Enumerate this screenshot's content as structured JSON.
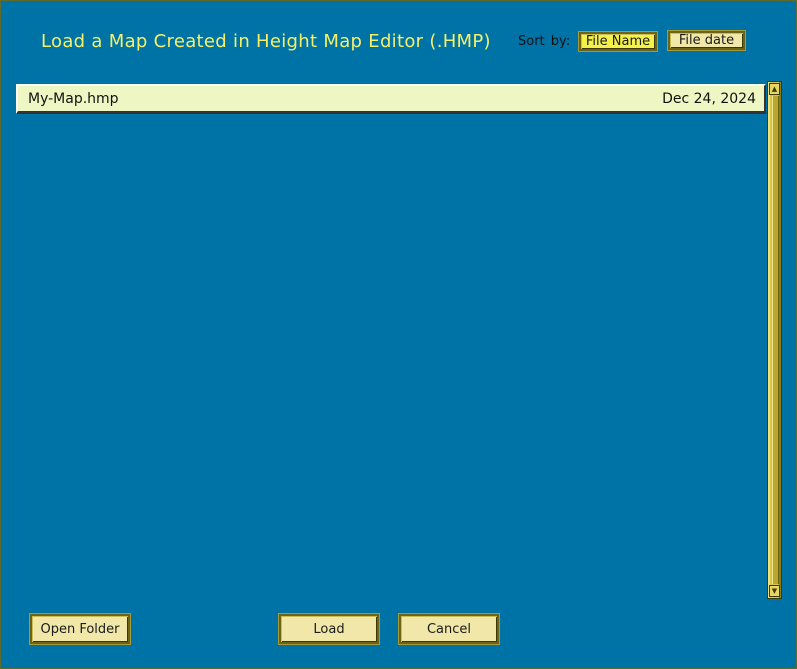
{
  "dialog": {
    "title": "Load a Map Created in Height Map Editor (.HMP)"
  },
  "sort": {
    "label": "Sort by:",
    "options": [
      {
        "label": "File Name",
        "selected": true
      },
      {
        "label": "File date",
        "selected": false
      }
    ]
  },
  "files": [
    {
      "name": "My-Map.hmp",
      "date": "Dec 24, 2024"
    }
  ],
  "buttons": {
    "open_folder": "Open Folder",
    "load": "Load",
    "cancel": "Cancel"
  },
  "colors": {
    "background": "#0073a6",
    "title": "#f4f06a",
    "button_face": "#f1e7a9",
    "active_sort": "#f4f24a",
    "row_background": "#eef7c3",
    "scrollbar": "#d6c34a"
  },
  "icons": {
    "scroll_up": "up-arrow-icon",
    "scroll_down": "down-arrow-icon"
  }
}
